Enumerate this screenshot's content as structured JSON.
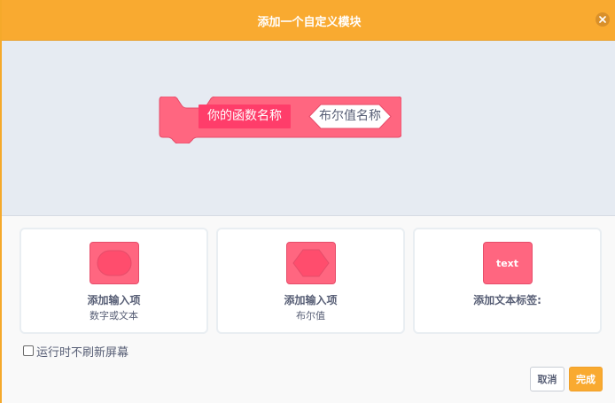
{
  "header": {
    "title": "添加一个自定义模块",
    "close_icon": "close-icon"
  },
  "workspace": {
    "block_name": "你的函数名称",
    "bool_input_label": "布尔值名称"
  },
  "cards": [
    {
      "label": "添加输入项",
      "sub": "数字或文本",
      "icon": "round-input-icon"
    },
    {
      "label": "添加输入项",
      "sub": "布尔值",
      "icon": "hexagon-input-icon"
    },
    {
      "label": "添加文本标签:",
      "sub": "",
      "icon_text": "text"
    }
  ],
  "options": {
    "run_without_refresh_label": "运行时不刷新屏幕",
    "run_without_refresh_checked": false
  },
  "footer": {
    "cancel_label": "取消",
    "ok_label": "完成"
  },
  "colors": {
    "header": "#f9aa30",
    "workspace": "#e6ebf2",
    "block": "#ff6680",
    "block_name_bg": "#ff3d6a",
    "text": "#575e75"
  }
}
